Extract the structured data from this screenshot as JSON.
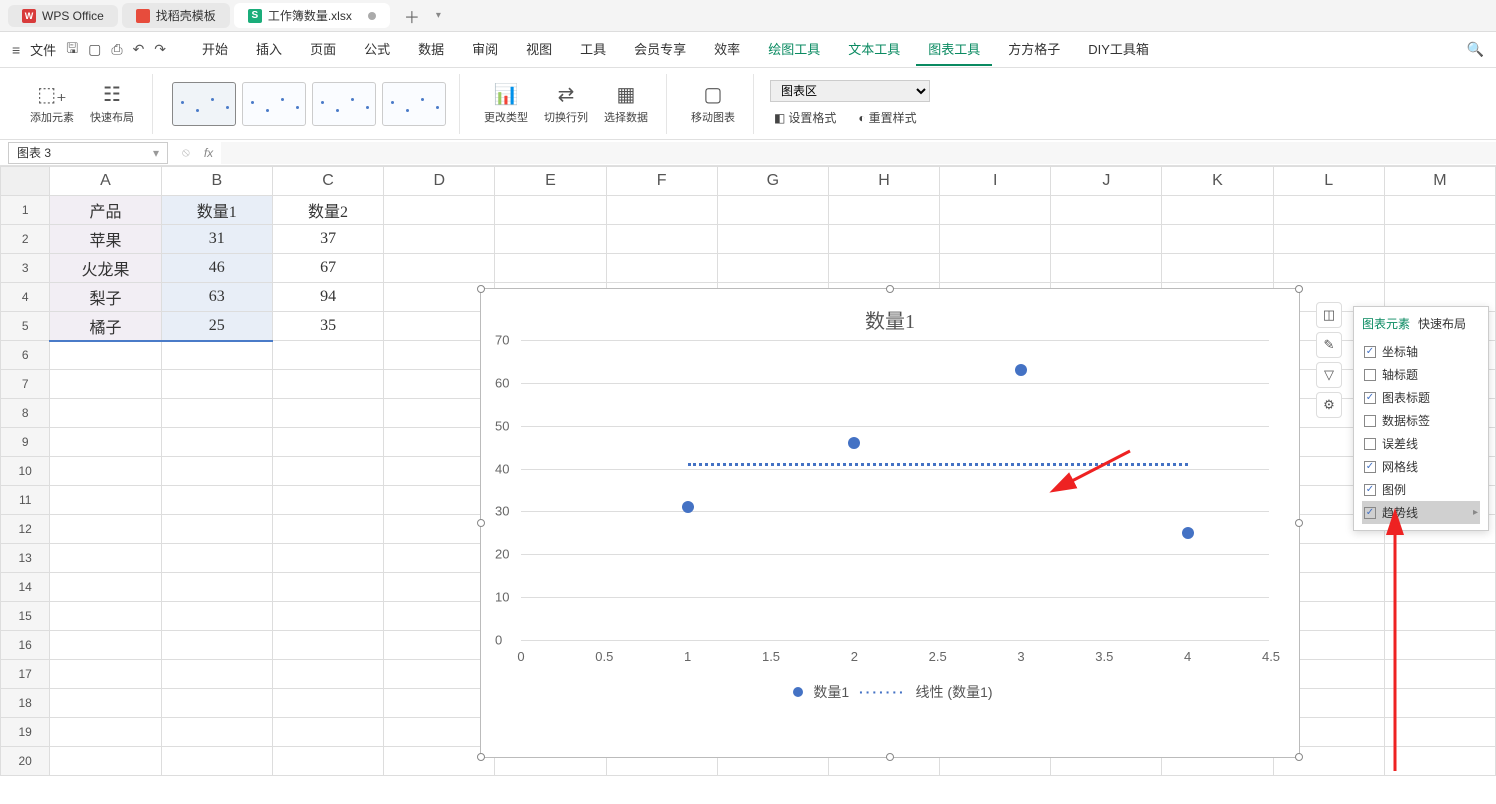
{
  "tabs": {
    "wps": "WPS Office",
    "dk": "找稻壳模板",
    "file": "工作簿数量.xlsx"
  },
  "menu": {
    "file_btn": "文件",
    "items": [
      "开始",
      "插入",
      "页面",
      "公式",
      "数据",
      "审阅",
      "视图",
      "工具",
      "会员专享",
      "效率",
      "绘图工具",
      "文本工具",
      "图表工具",
      "方方格子",
      "DIY工具箱"
    ]
  },
  "ribbon": {
    "add_element": "添加元素",
    "quick_layout": "快速布局",
    "change_type": "更改类型",
    "switch_rc": "切换行列",
    "select_data": "选择数据",
    "move_chart": "移动图表",
    "chart_area": "图表区",
    "set_format": "设置格式",
    "reset_style": "重置样式"
  },
  "namebox": "图表 3",
  "sheet": {
    "cols": [
      "A",
      "B",
      "C",
      "D",
      "E",
      "F",
      "G",
      "H",
      "I",
      "J",
      "K",
      "L",
      "M"
    ],
    "rows": 20,
    "headers": {
      "a1": "产品",
      "b1": "数量1",
      "c1": "数量2"
    },
    "data": [
      {
        "a": "苹果",
        "b": "31",
        "c": "37"
      },
      {
        "a": "火龙果",
        "b": "46",
        "c": "67"
      },
      {
        "a": "梨子",
        "b": "63",
        "c": "94"
      },
      {
        "a": "橘子",
        "b": "25",
        "c": "35"
      }
    ]
  },
  "chart_data": {
    "type": "scatter",
    "title": "数量1",
    "x": [
      1,
      2,
      3,
      4
    ],
    "series": [
      {
        "name": "数量1",
        "values": [
          31,
          46,
          63,
          25
        ]
      }
    ],
    "trendline": {
      "name": "线性 (数量1)",
      "display_level": 41.25
    },
    "xlabel": "",
    "ylabel": "",
    "xlim": [
      0,
      4.5
    ],
    "ylim": [
      0,
      70
    ],
    "x_ticks": [
      "0",
      "0.5",
      "1",
      "1.5",
      "2",
      "2.5",
      "3",
      "3.5",
      "4",
      "4.5"
    ],
    "y_ticks": [
      "0",
      "10",
      "20",
      "30",
      "40",
      "50",
      "60",
      "70"
    ],
    "legend": {
      "series": "数量1",
      "trend": "线性 (数量1)"
    }
  },
  "panel": {
    "tab1": "图表元素",
    "tab2": "快速布局",
    "items": [
      {
        "key": "axis",
        "label": "坐标轴",
        "checked": true
      },
      {
        "key": "axis_title",
        "label": "轴标题",
        "checked": false
      },
      {
        "key": "chart_title",
        "label": "图表标题",
        "checked": true
      },
      {
        "key": "data_label",
        "label": "数据标签",
        "checked": false
      },
      {
        "key": "error_bar",
        "label": "误差线",
        "checked": false
      },
      {
        "key": "gridline",
        "label": "网格线",
        "checked": true
      },
      {
        "key": "legend",
        "label": "图例",
        "checked": true
      },
      {
        "key": "trendline",
        "label": "趋势线",
        "checked": true,
        "highlight": true,
        "chev": true
      }
    ]
  }
}
